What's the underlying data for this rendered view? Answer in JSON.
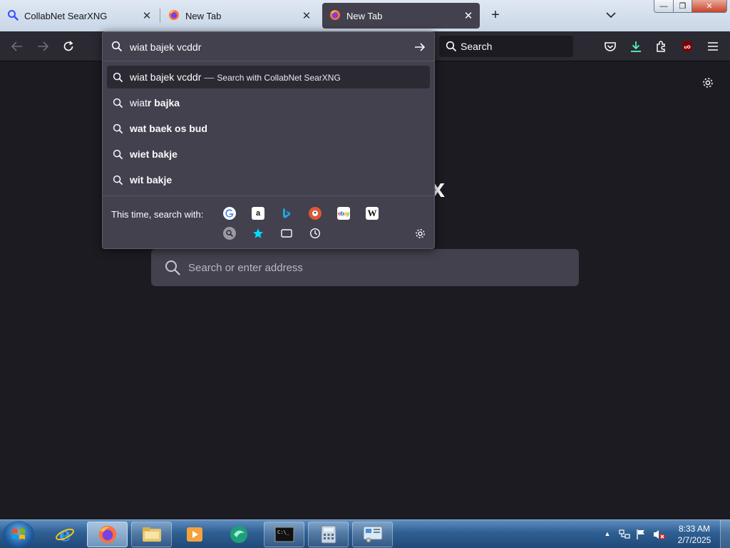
{
  "tabs": [
    {
      "label": "CollabNet SearXNG",
      "icon": "searxng-magnifier-icon"
    },
    {
      "label": "New Tab",
      "icon": "firefox-icon"
    },
    {
      "label": "New Tab",
      "icon": "firefox-icon",
      "active": true
    }
  ],
  "toolbar": {
    "search_placeholder": "Search"
  },
  "urlbar": {
    "value": "wiat bajek vcddr",
    "results": [
      {
        "typed": "wiat bajek vcddr",
        "action": "Search with CollabNet SearXNG",
        "selected": true
      },
      {
        "prefix": "wiat",
        "completion": "r bajka"
      },
      {
        "prefix": "",
        "completion": "wat baek os bud"
      },
      {
        "prefix": "",
        "completion": "wiet bakje"
      },
      {
        "prefix": "",
        "completion": "wit bakje"
      }
    ],
    "oneoff_label": "This time, search with:",
    "engines": [
      "Google",
      "Amazon.com",
      "Bing",
      "DuckDuckGo",
      "eBay",
      "Wikipedia (en)"
    ],
    "modes": [
      "SearXNG",
      "Bookmarks",
      "Tabs",
      "History"
    ]
  },
  "newtab": {
    "wordmark_tail": "x",
    "search_placeholder": "Search or enter address"
  },
  "taskbar": {
    "items": [
      "Internet Explorer",
      "Firefox",
      "File Explorer",
      "Media Player",
      "Browser",
      "Command Prompt",
      "Calculator",
      "Control Panel"
    ],
    "clock_time": "8:33 AM",
    "clock_date": "2/7/2025"
  },
  "colors": {
    "toolbar": "#2b2a33",
    "page_bg": "#1c1b22",
    "dropdown_bg": "#42414d",
    "accent_download": "#54ffbd"
  }
}
